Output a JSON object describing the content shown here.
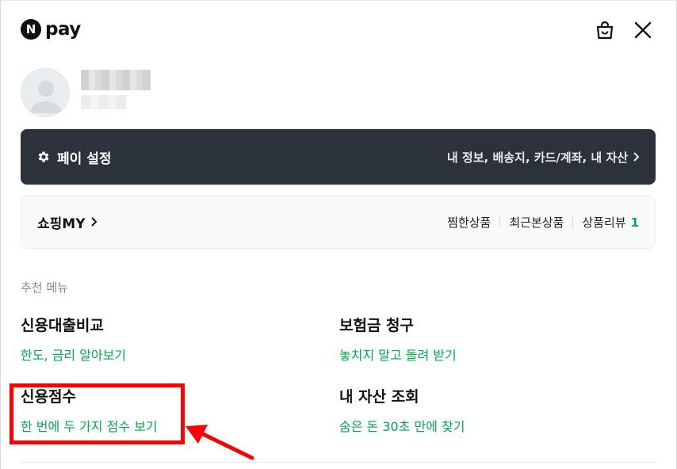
{
  "header": {
    "logo_letter": "N",
    "logo_text": "pay",
    "cart_icon": "shopping-bag-icon",
    "close_icon": "close-icon"
  },
  "profile": {
    "avatar_icon": "default-avatar-icon"
  },
  "pay_settings": {
    "icon": "gear-icon",
    "title": "페이 설정",
    "detail": "내 정보, 배송지, 카드/계좌, 내 자산",
    "chevron": "›"
  },
  "shopping_my": {
    "title": "쇼핑MY",
    "chevron": "›",
    "links": [
      {
        "label": "찜한상품"
      },
      {
        "label": "최근본상품"
      },
      {
        "label": "상품리뷰",
        "count": "1"
      }
    ]
  },
  "recommended": {
    "title": "추천 메뉴",
    "items": [
      {
        "name": "신용대출비교",
        "desc": "한도, 금리 알아보기"
      },
      {
        "name": "보험금 청구",
        "desc": "놓치지 말고 돌려 받기"
      },
      {
        "name": "신용점수",
        "desc": "한 번에 두 가지 점수 보기"
      },
      {
        "name": "내 자산 조회",
        "desc": "숨은 돈 30초 만에 찾기"
      }
    ]
  },
  "colors": {
    "accent_green": "#03a94d",
    "dark_panel": "#2b323b",
    "annotation_red": "#ff0000"
  }
}
